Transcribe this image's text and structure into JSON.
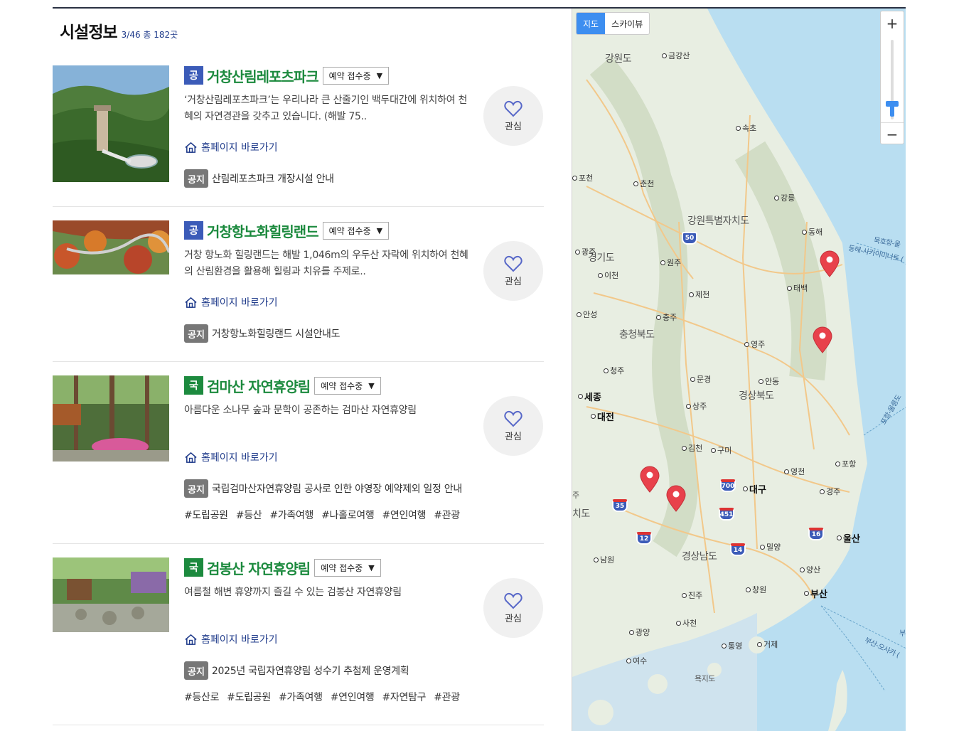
{
  "list": {
    "title": "시설정보",
    "count": "3/46 총 182곳"
  },
  "common": {
    "homepage_label": "홈페이지 바로가기",
    "notice_badge": "공지",
    "favorite_label": "관심"
  },
  "items": [
    {
      "badge": "공",
      "title": "거창산림레포츠파크",
      "status": "예약 접수중",
      "description": "‘거창산림레포츠파크’는 우리나라 큰 산줄기인 백두대간에 위치하여 천혜의 자연경관을 갖추고 있습니다. (해발 75..",
      "notice": "산림레포츠파크 개장시설 안내",
      "tags": []
    },
    {
      "badge": "공",
      "title": "거창항노화힐링랜드",
      "status": "예약 접수중",
      "description": "거창 항노화 힐링랜드는 해발 1,046m의 우두산 자락에 위치하여 천혜의 산림환경을 활용해 힐링과 치유를 주제로..",
      "notice": "거창항노화힐링랜드 시설안내도",
      "tags": []
    },
    {
      "badge": "국",
      "title": "검마산 자연휴양림",
      "status": "예약 접수중",
      "description": "아름다운 소나무 숲과 문학이 공존하는 검마산 자연휴양림",
      "notice": "국립검마산자연휴양림 공사로 인한 야영장 예약제외 일정 안내",
      "tags": [
        "#도립공원",
        "#등산",
        "#가족여행",
        "#나홀로여행",
        "#연인여행",
        "#관광"
      ]
    },
    {
      "badge": "국",
      "title": "검봉산 자연휴양림",
      "status": "예약 접수중",
      "description": "여름철 해변 휴양까지 즐길 수 있는 검봉산 자연휴양림",
      "notice": "2025년 국립자연휴양림 성수기 추첨제 운영계획",
      "tags": [
        "#등산로",
        "#도립공원",
        "#가족여행",
        "#연인여행",
        "#자연탐구",
        "#관광"
      ]
    }
  ],
  "map": {
    "type_map": "지도",
    "type_sky": "스카이뷰",
    "zoom_in": "+",
    "zoom_out": "−",
    "regions": {
      "gangwon": "강원도",
      "gangwon_special": "강원특별자치도",
      "gyeonggi": "경기도",
      "chungbuk": "충청북도",
      "gyeongbuk": "경상북도",
      "gyeongnam": "경상남도",
      "jeonbuk": "치도"
    },
    "cities": {
      "geumgang": "금강산",
      "sokcho": "속초",
      "pocheon": "포천",
      "chuncheon": "춘천",
      "gangneung": "강릉",
      "donghae": "동해",
      "gwangju_g": "광주",
      "wonju": "원주",
      "icheon": "이천",
      "taebaek": "태백",
      "jecheon": "제천",
      "anseong": "안성",
      "chungju": "충주",
      "yeongju": "영주",
      "cheongju": "청주",
      "mungyeong": "문경",
      "andong": "안동",
      "sejong": "세종",
      "daejeon": "대전",
      "sangju": "상주",
      "gimcheon": "김천",
      "gumi": "구미",
      "pohang": "포항",
      "yeongcheon": "영천",
      "daegu": "대구",
      "gyeongju": "경주",
      "ulsan": "울산",
      "miryang": "밀양",
      "namwon": "남원",
      "yangsan": "양산",
      "changwon": "창원",
      "busan": "부산",
      "jinju": "진주",
      "sacheon": "사천",
      "gwangyang": "광양",
      "tongyeong": "통영",
      "geoje": "거제",
      "yeosu": "여수",
      "mokdo": "욕지도",
      "jeonju": "주"
    },
    "highways": [
      "50",
      "700",
      "35",
      "451",
      "12",
      "16",
      "14"
    ],
    "sea_routes": {
      "mukho": "묵호항-울",
      "donghae_route": "동해-사카이미나토 (",
      "pohang_route": "포항-울릉도",
      "busan_route": "부산-오사카 (",
      "sea_label": "부"
    }
  }
}
